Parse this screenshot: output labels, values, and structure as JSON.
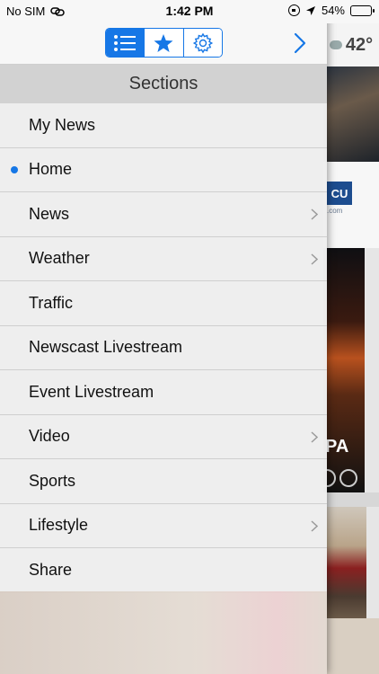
{
  "status_bar": {
    "carrier": "No SIM",
    "time": "1:42 PM",
    "battery_text": "54%",
    "battery_level": 0.54
  },
  "background": {
    "temperature": "42°",
    "ad_logo": "CU",
    "ad_url": ".com",
    "brand_text": "PA"
  },
  "drawer": {
    "header": "Sections",
    "toolbar": {
      "segments": [
        {
          "icon": "list-icon",
          "active": true
        },
        {
          "icon": "star-icon",
          "active": false
        },
        {
          "icon": "gear-icon",
          "active": false
        }
      ],
      "forward_icon": "chevron-right-icon"
    },
    "items": [
      {
        "label": "My News",
        "selected": false,
        "has_submenu": false
      },
      {
        "label": "Home",
        "selected": true,
        "has_submenu": false
      },
      {
        "label": "News",
        "selected": false,
        "has_submenu": true
      },
      {
        "label": "Weather",
        "selected": false,
        "has_submenu": true
      },
      {
        "label": "Traffic",
        "selected": false,
        "has_submenu": false
      },
      {
        "label": "Newscast Livestream",
        "selected": false,
        "has_submenu": false
      },
      {
        "label": "Event Livestream",
        "selected": false,
        "has_submenu": false
      },
      {
        "label": "Video",
        "selected": false,
        "has_submenu": true
      },
      {
        "label": "Sports",
        "selected": false,
        "has_submenu": false
      },
      {
        "label": "Lifestyle",
        "selected": false,
        "has_submenu": true
      },
      {
        "label": "Share",
        "selected": false,
        "has_submenu": false
      }
    ]
  },
  "colors": {
    "accent": "#1677e6",
    "header_bg": "#d2d2d2"
  }
}
